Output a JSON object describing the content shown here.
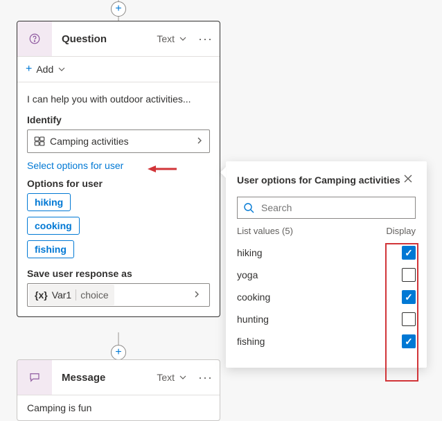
{
  "question_card": {
    "title": "Question",
    "type_tag": "Text",
    "add_label": "Add",
    "prompt": "I can help you with outdoor activities...",
    "identify_label": "Identify",
    "identify_value": "Camping activities",
    "select_link": "Select options for user",
    "options_label": "Options for user",
    "options": [
      "hiking",
      "cooking",
      "fishing"
    ],
    "save_label": "Save user response as",
    "var_name": "Var1",
    "var_type": "choice"
  },
  "popover": {
    "title": "User options for Camping activities",
    "search_placeholder": "Search",
    "list_head": "List values (5)",
    "display_head": "Display",
    "items": [
      {
        "name": "hiking",
        "display": true
      },
      {
        "name": "yoga",
        "display": false
      },
      {
        "name": "cooking",
        "display": true
      },
      {
        "name": "hunting",
        "display": false
      },
      {
        "name": "fishing",
        "display": true
      }
    ]
  },
  "message_card": {
    "title": "Message",
    "type_tag": "Text",
    "body": "Camping is fun"
  }
}
